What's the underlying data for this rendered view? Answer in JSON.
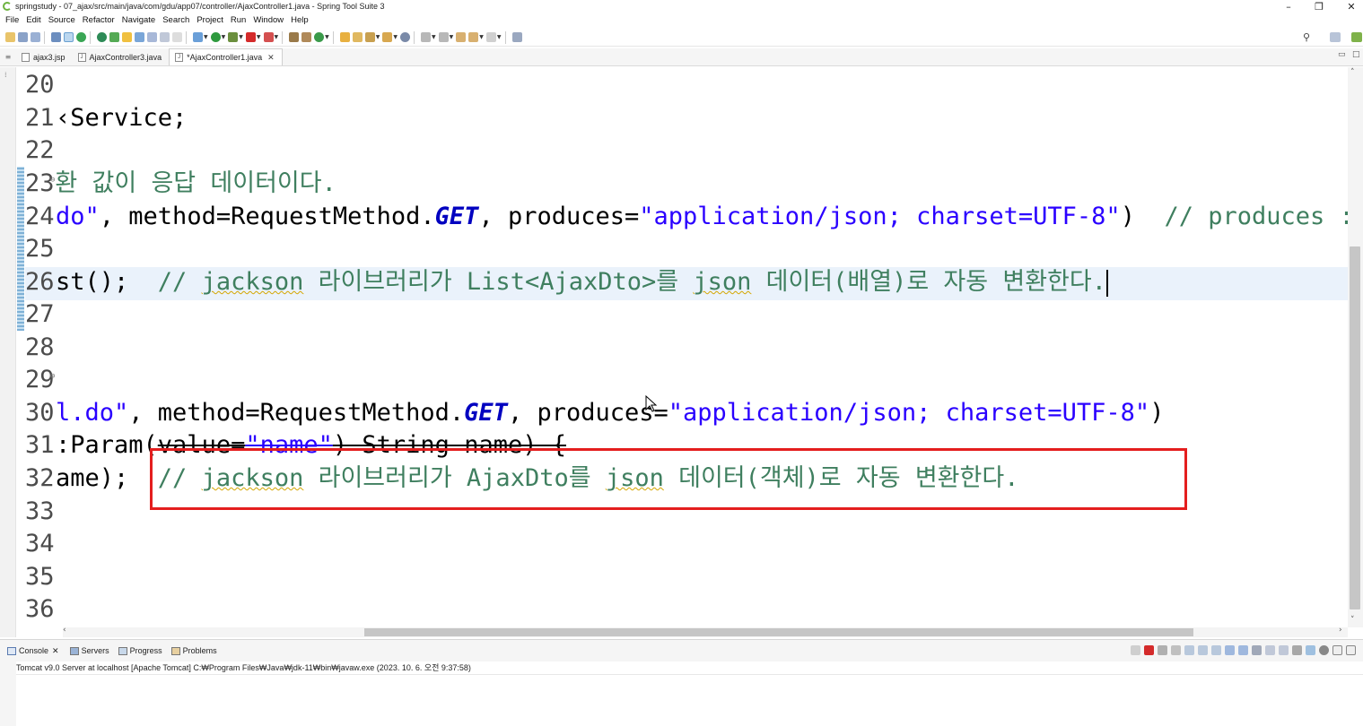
{
  "window": {
    "title": "springstudy - 07_ajax/src/main/java/com/gdu/app07/controller/AjaxController1.java - Spring Tool Suite 3",
    "minimize": "–",
    "maximize": "❐",
    "close": "✕"
  },
  "menu": [
    "File",
    "Edit",
    "Source",
    "Refactor",
    "Navigate",
    "Search",
    "Project",
    "Run",
    "Window",
    "Help"
  ],
  "tabs": [
    {
      "label": "ajax3.jsp",
      "active": false
    },
    {
      "label": "AjaxController3.java",
      "active": false
    },
    {
      "label": "*AjaxController1.java",
      "active": true
    }
  ],
  "editor": {
    "lines": [
      {
        "num": "20",
        "code": ""
      },
      {
        "num": "21",
        "code": "‹Service;"
      },
      {
        "num": "22",
        "code": ""
      },
      {
        "num": "23",
        "comment": "환 값이 응답 데이터이다."
      },
      {
        "num": "24",
        "pre": "",
        "s1": "do\"",
        "mid1": ", method=RequestMethod.",
        "it": "GET",
        "mid2": ", produces=",
        "s2": "\"application/json; charset=UTF-8\"",
        "mid3": ")  ",
        "cmt": "// produces : 응"
      },
      {
        "num": "25",
        "code": ""
      },
      {
        "num": "26",
        "code": "st();  ",
        "cmt_pre": "// ",
        "spell1": "jackson",
        "cmt_mid": " 라이브러리가 List<AjaxDto>를 ",
        "spell2": "json",
        "cmt_post": " 데이터(배열)로 자동 변환한다."
      },
      {
        "num": "27",
        "code": ""
      },
      {
        "num": "28",
        "code": ""
      },
      {
        "num": "29",
        "code": ""
      },
      {
        "num": "30",
        "pre": "l.do\"",
        "mid1": ", method=RequestMethod.",
        "it": "GET",
        "mid2": ", produces=",
        "s2": "\"application/json; charset=UTF-8\"",
        "mid3": ")"
      },
      {
        "num": "31",
        "code": ":Param(",
        "strike1": "value=",
        "s": "\"name\"",
        "strike2": ") String name) {"
      },
      {
        "num": "32",
        "code": "ame);  ",
        "cmt_pre": "// ",
        "spell1": "jackson",
        "cmt_mid": " 라이브러리가 AjaxDto를 ",
        "spell2": "json",
        "cmt_post": " 데이터(객체)로 자동 변환한다."
      },
      {
        "num": "33",
        "code": ""
      },
      {
        "num": "34",
        "code": ""
      },
      {
        "num": "35",
        "code": ""
      },
      {
        "num": "36",
        "code": ""
      }
    ]
  },
  "bottom_panel": {
    "tabs": [
      "Console",
      "Servers",
      "Progress",
      "Problems"
    ],
    "console_label": "Tomcat v9.0 Server at localhost [Apache Tomcat] C:₩Program Files₩Java₩jdk-11₩bin₩javaw.exe  (2023. 10. 6. 오전 9:37:58)"
  },
  "colors": {
    "comment": "#3f7f5f",
    "string": "#2a00ff",
    "constant": "#0000c0",
    "current_line": "#eaf2fb",
    "annotation_box": "#e41e1e"
  }
}
